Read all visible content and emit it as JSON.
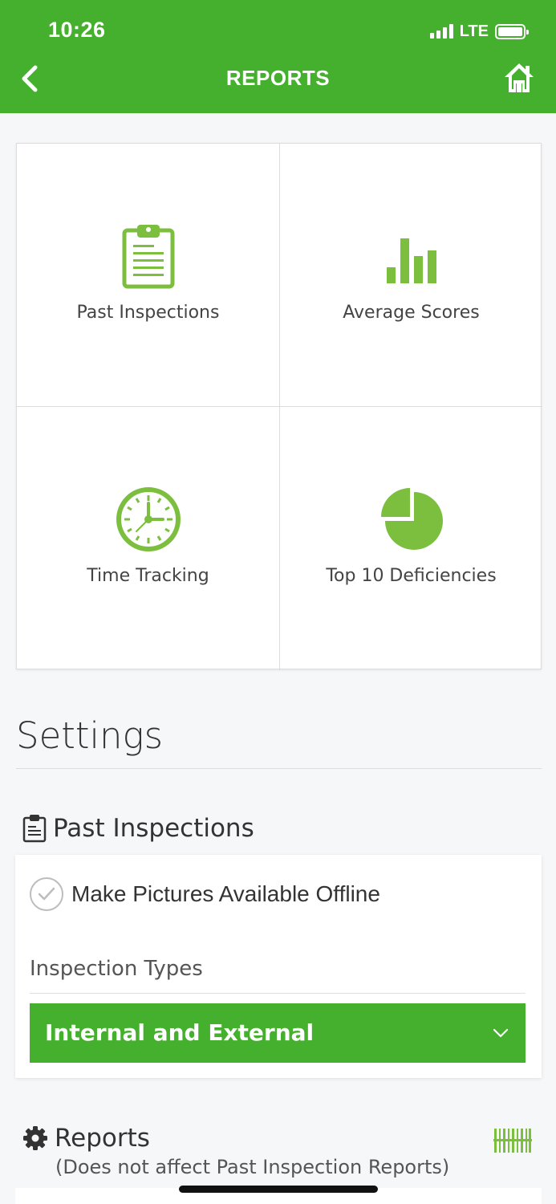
{
  "status_bar": {
    "time": "10:26",
    "network": "LTE"
  },
  "header": {
    "title": "REPORTS"
  },
  "tiles": [
    {
      "label": "Past Inspections",
      "icon": "clipboard-icon"
    },
    {
      "label": "Average Scores",
      "icon": "bar-chart-icon"
    },
    {
      "label": "Time Tracking",
      "icon": "clock-icon"
    },
    {
      "label": "Top 10 Deficiencies",
      "icon": "pie-chart-icon"
    }
  ],
  "settings": {
    "title": "Settings",
    "past_inspections": {
      "heading": "Past Inspections",
      "offline_label": "Make Pictures Available Offline",
      "types_label": "Inspection Types",
      "types_value": "Internal and External"
    },
    "reports": {
      "heading": "Reports",
      "subtitle": "(Does not affect Past Inspection Reports)"
    }
  },
  "colors": {
    "brand_green": "#44b02d",
    "icon_green": "#7cbf3f"
  }
}
